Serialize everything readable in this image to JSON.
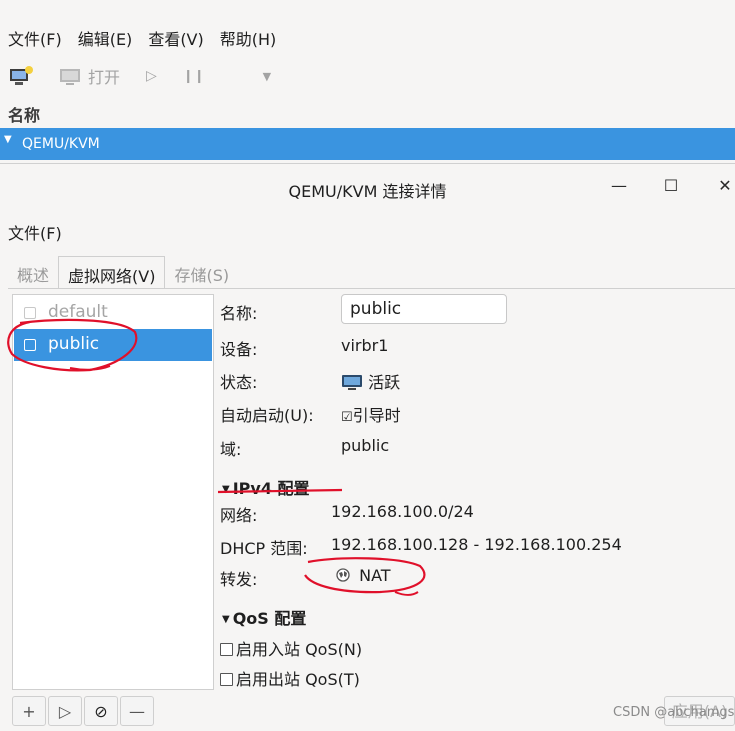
{
  "main_window": {
    "menu": [
      "文件(F)",
      "编辑(E)",
      "查看(V)",
      "帮助(H)"
    ],
    "toolbar": {
      "open_label": "打开"
    },
    "column_header": "名称",
    "connection": "QEMU/KVM"
  },
  "dialog": {
    "title": "QEMU/KVM 连接详情",
    "menu_file": "文件(F)",
    "window_buttons": {
      "minimize": "—",
      "maximize": "☐",
      "close": "✕"
    },
    "tabs": [
      "概述",
      "虚拟网络(V)",
      "存储(S)"
    ],
    "networks": [
      "default",
      "public"
    ],
    "details": {
      "name_label": "名称:",
      "name_value": "public",
      "device_label": "设备:",
      "device_value": "virbr1",
      "state_label": "状态:",
      "state_value": "活跃",
      "autostart_label": "自动启动(U):",
      "autostart_value": "引导时",
      "domain_label": "域:",
      "domain_value": "public"
    },
    "ipv4": {
      "section_title": "IPv4 配置",
      "network_label": "网络:",
      "network_value": "192.168.100.0/24",
      "dhcp_label": "DHCP 范围:",
      "dhcp_value": "192.168.100.128 - 192.168.100.254",
      "forward_label": "转发:",
      "forward_value": "NAT"
    },
    "qos": {
      "section_title": "QoS 配置",
      "inbound": "启用入站 QoS(N)",
      "outbound": "启用出站 QoS(T)"
    },
    "bottom_buttons": [
      "+",
      "▷",
      "⊘",
      "—"
    ],
    "apply_label": "应用(A)",
    "watermark": "CSDN @abchamgs"
  },
  "colors": {
    "selection": "#3a94e0",
    "annotation": "#e0102a"
  }
}
